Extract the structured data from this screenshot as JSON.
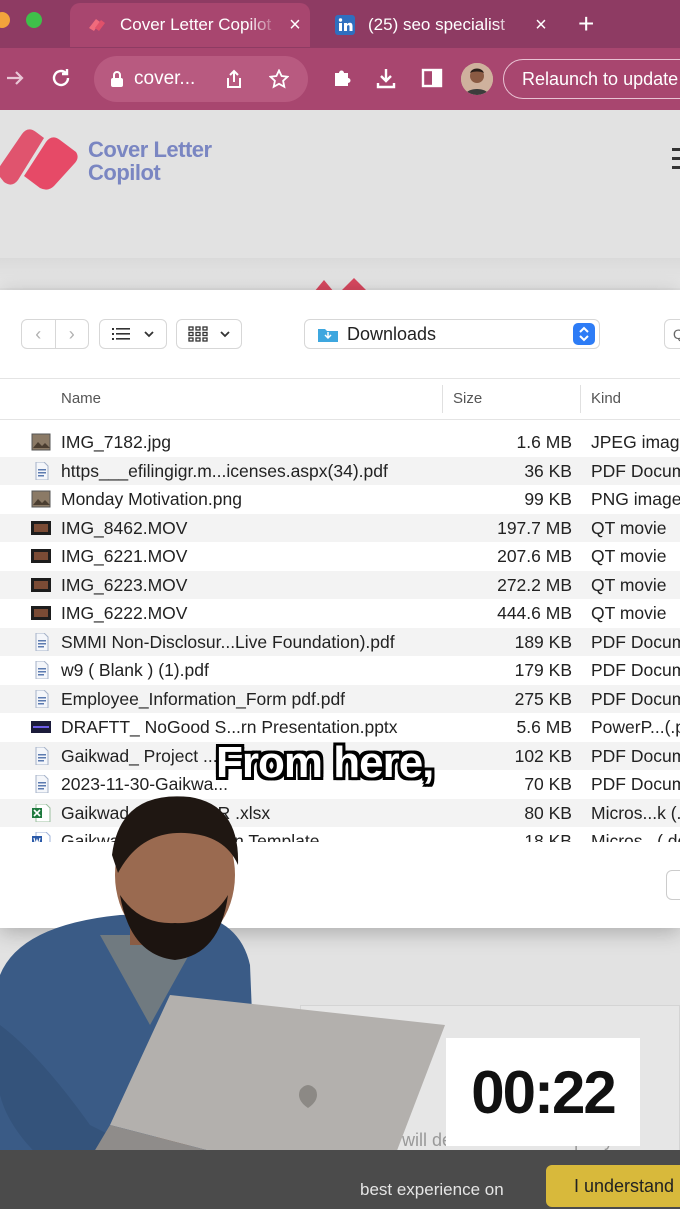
{
  "browser": {
    "tabs": [
      {
        "title": "Cover Letter Copilot",
        "active": true,
        "close": "×"
      },
      {
        "title": "(25) seo specialist",
        "active": false,
        "close": "×"
      }
    ],
    "new_tab": "+",
    "address": "cover...",
    "relaunch_label": "Relaunch to update",
    "brand_color": "#a8466f"
  },
  "site": {
    "logo_line1": "Cover Letter",
    "logo_line2": "Copilot"
  },
  "dialog": {
    "location": "Downloads",
    "columns": {
      "name": "Name",
      "size": "Size",
      "kind": "Kind"
    },
    "files": [
      {
        "name": "IMG_7182.jpg",
        "size": "1.6 MB",
        "kind": "JPEG image",
        "icon": "image-file-icon"
      },
      {
        "name": "https___efilingigr.m...icenses.aspx(34).pdf",
        "size": "36 KB",
        "kind": "PDF Document",
        "icon": "pdf-file-icon"
      },
      {
        "name": "Monday Motivation.png",
        "size": "99 KB",
        "kind": "PNG image",
        "icon": "image-file-icon"
      },
      {
        "name": "IMG_8462.MOV",
        "size": "197.7 MB",
        "kind": "QT movie",
        "icon": "movie-file-icon"
      },
      {
        "name": "IMG_6221.MOV",
        "size": "207.6 MB",
        "kind": "QT movie",
        "icon": "movie-file-icon"
      },
      {
        "name": "IMG_6223.MOV",
        "size": "272.2 MB",
        "kind": "QT movie",
        "icon": "movie-file-icon"
      },
      {
        "name": "IMG_6222.MOV",
        "size": "444.6 MB",
        "kind": "QT movie",
        "icon": "movie-file-icon"
      },
      {
        "name": "SMMI Non-Disclosur...Live Foundation).pdf",
        "size": "189 KB",
        "kind": "PDF Document",
        "icon": "pdf-file-icon"
      },
      {
        "name": "w9 ( Blank ) (1).pdf",
        "size": "179 KB",
        "kind": "PDF Document",
        "icon": "pdf-file-icon"
      },
      {
        "name": "Employee_Information_Form pdf.pdf",
        "size": "275 KB",
        "kind": "PDF Document",
        "icon": "pdf-file-icon"
      },
      {
        "name": "DRAFTT_ NoGood S...rn Presentation.pptx",
        "size": "5.6 MB",
        "kind": "PowerP...(.pptx)",
        "icon": "pptx-file-icon"
      },
      {
        "name": "Gaikwad_ Project ...",
        "size": "102 KB",
        "kind": "PDF Document",
        "icon": "pdf-file-icon"
      },
      {
        "name": "2023-11-30-Gaikwa...",
        "size": "70 KB",
        "kind": "PDF Document",
        "icon": "pdf-file-icon"
      },
      {
        "name": "Gaikwad_...EGISTER .xlsx",
        "size": "80 KB",
        "kind": "Micros...k (.xlsx)",
        "icon": "xlsx-file-icon"
      },
      {
        "name": "Gaikwad_...ication Plan Template",
        "size": "18 KB",
        "kind": "Micros...(.docx)",
        "icon": "docx-file-icon"
      }
    ]
  },
  "overlay": {
    "caption": "From here,",
    "timer": "00:22",
    "cookie_text": "best experience on",
    "cookie_button": "I understand",
    "quote_fragment": "will deliver to the company\""
  }
}
